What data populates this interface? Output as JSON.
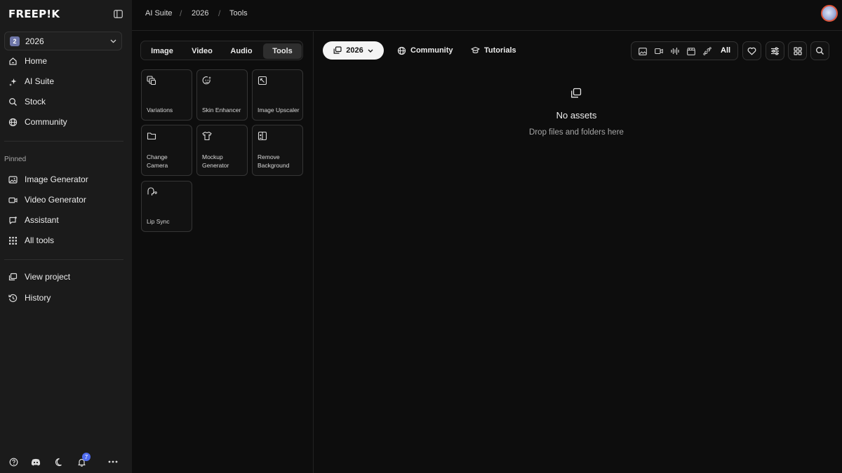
{
  "app": {
    "logo": "FREEP!K"
  },
  "sidebar": {
    "project": {
      "badge": "2",
      "name": "2026"
    },
    "main_nav": [
      {
        "label": "Home",
        "icon": "home-icon"
      },
      {
        "label": "AI Suite",
        "icon": "sparkle-icon"
      },
      {
        "label": "Stock",
        "icon": "search-icon"
      },
      {
        "label": "Community",
        "icon": "globe-icon"
      }
    ],
    "pinned_label": "Pinned",
    "pinned": [
      {
        "label": "Image Generator",
        "icon": "image-icon"
      },
      {
        "label": "Video Generator",
        "icon": "video-icon"
      },
      {
        "label": "Assistant",
        "icon": "chat-icon"
      },
      {
        "label": "All tools",
        "icon": "grid-dots-icon"
      }
    ],
    "footer_nav": [
      {
        "label": "View project",
        "icon": "stack-icon"
      },
      {
        "label": "History",
        "icon": "history-icon"
      }
    ],
    "bottom": {
      "notification_count": "7"
    }
  },
  "breadcrumb": [
    "AI Suite",
    "2026",
    "Tools"
  ],
  "tools_panel": {
    "tabs": [
      "Image",
      "Video",
      "Audio",
      "Tools"
    ],
    "active_tab": "Tools",
    "cards": [
      {
        "label": "Variations",
        "icon": "variations-icon"
      },
      {
        "label": "Skin Enhancer",
        "icon": "skin-enhancer-icon"
      },
      {
        "label": "Image Upscaler",
        "icon": "upscale-icon"
      },
      {
        "label": "Change Camera",
        "icon": "camera-folder-icon"
      },
      {
        "label": "Mockup Generator",
        "icon": "shirt-icon"
      },
      {
        "label": "Remove Background",
        "icon": "remove-bg-icon"
      },
      {
        "label": "Lip Sync",
        "icon": "lip-sync-icon"
      }
    ]
  },
  "main": {
    "project_button": "2026",
    "community_link": "Community",
    "tutorials_link": "Tutorials",
    "filter_all": "All",
    "empty_state": {
      "title": "No assets",
      "subtitle": "Drop files and folders here"
    }
  }
}
